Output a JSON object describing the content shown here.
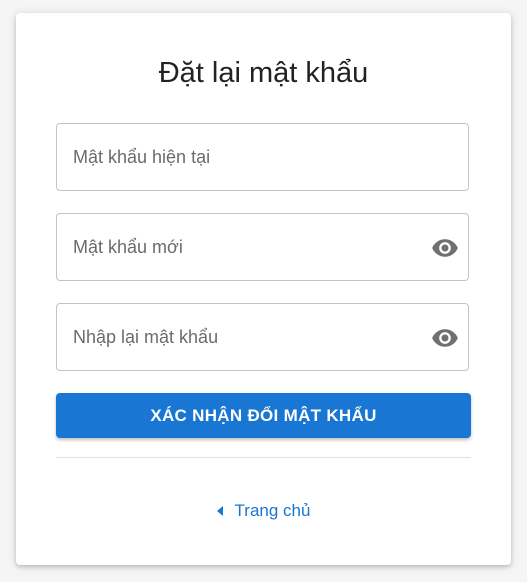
{
  "form": {
    "title": "Đặt lại mật khẩu",
    "fields": [
      {
        "placeholder": "Mật khẩu hiện tại",
        "value": ""
      },
      {
        "placeholder": "Mật khẩu mới",
        "value": "",
        "icon": "eye-icon"
      },
      {
        "placeholder": "Nhập lại mật khẩu",
        "value": "",
        "icon": "eye-icon"
      }
    ],
    "submit_label": "XÁC NHẬN ĐỔI MẬT KHẨU",
    "home_link_label": "Trang chủ",
    "home_link_icon": "caret-left-icon"
  },
  "colors": {
    "primary": "#1976d2",
    "icon": "#707070",
    "border": "#c4c4c4",
    "background": "#f5f5f5"
  }
}
